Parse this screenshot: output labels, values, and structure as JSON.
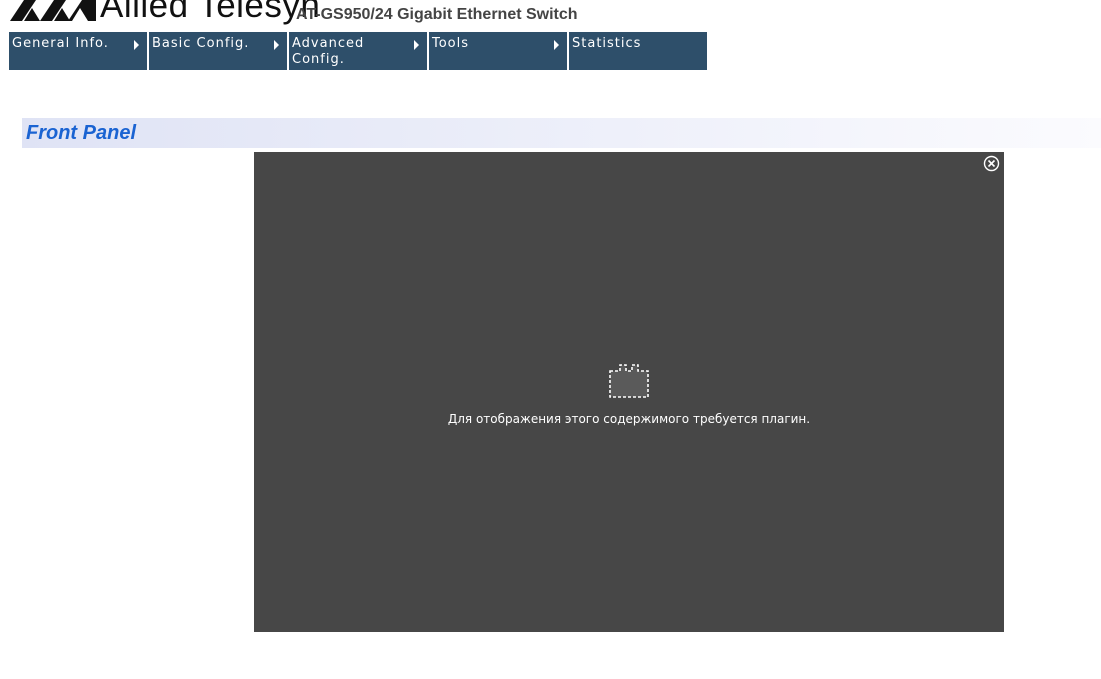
{
  "header": {
    "logo_text": "Allied Telesyn",
    "product_title": "AT-GS950/24 Gigabit Ethernet Switch"
  },
  "nav": {
    "items": [
      {
        "label": "General Info.",
        "has_submenu": true
      },
      {
        "label": "Basic Config.",
        "has_submenu": true
      },
      {
        "label": "Advanced Config.",
        "has_submenu": true
      },
      {
        "label": "Tools",
        "has_submenu": true
      },
      {
        "label": "Statistics",
        "has_submenu": false
      }
    ]
  },
  "section": {
    "title": "Front Panel"
  },
  "plugin": {
    "message": "Для отображения этого содержимого требуется плагин.",
    "icon": "plugin-missing-icon",
    "close_icon": "close-circle-icon"
  },
  "colors": {
    "nav_bg": "#2e4f6a",
    "section_title": "#1a63d2",
    "plugin_bg": "#474747"
  }
}
